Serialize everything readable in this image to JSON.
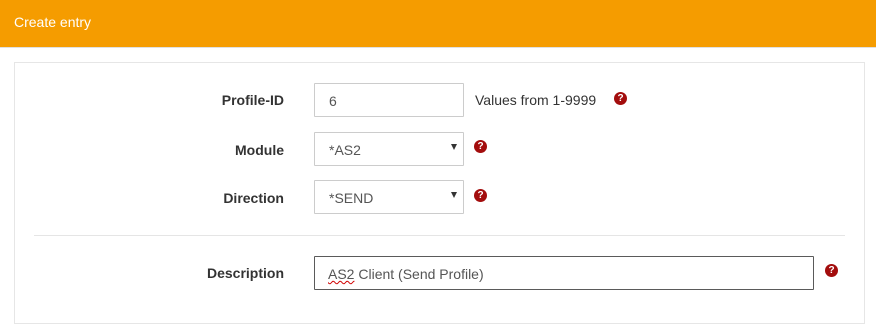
{
  "header": {
    "title": "Create entry"
  },
  "form": {
    "profile_id": {
      "label": "Profile-ID",
      "value": "6",
      "hint": "Values from 1-9999"
    },
    "module": {
      "label": "Module",
      "value": "*AS2"
    },
    "direction": {
      "label": "Direction",
      "value": "*SEND"
    },
    "description": {
      "label": "Description",
      "value_prefix": "AS2",
      "value_rest": " Client (Send Profile)"
    }
  },
  "icons": {
    "help": "question-circle-icon"
  },
  "colors": {
    "header_bg": "#f59c00",
    "help_icon": "#a30d0d"
  }
}
